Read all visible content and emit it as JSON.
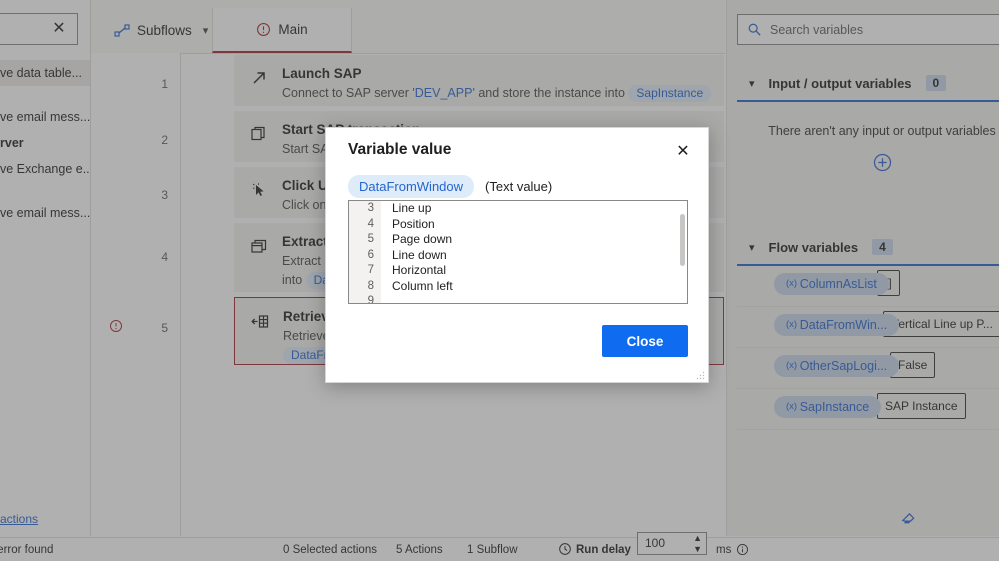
{
  "left_pane": {
    "search": {
      "value": "",
      "clear_icon": "close-icon"
    },
    "tree_items": [
      {
        "label": "ve data table...",
        "selected": true,
        "bold": false
      },
      {
        "label": "",
        "selected": false,
        "bold": false
      },
      {
        "label": "ve email mess...",
        "selected": false,
        "bold": false
      },
      {
        "label": "rver",
        "selected": false,
        "bold": true
      },
      {
        "label": "ve Exchange e...",
        "selected": false,
        "bold": false
      },
      {
        "label": "",
        "selected": false,
        "bold": false
      },
      {
        "label": "ve email mess...",
        "selected": false,
        "bold": false
      }
    ],
    "bottom_link": "actions"
  },
  "tabs": {
    "subflows": {
      "label": "Subflows",
      "icon": "subflow-icon",
      "chevron": "chevron-down-icon"
    },
    "main": {
      "label": "Main",
      "icon": "error-circle-icon",
      "active": true
    }
  },
  "actions": [
    {
      "number": "1",
      "icon": "launch-arrow-icon",
      "title": "Launch SAP",
      "desc_before": "Connect to SAP server ",
      "desc_quoted": "'DEV_APP'",
      "desc_middle": " and store the instance into ",
      "desc_chip": "SapInstance",
      "desc_after": ".",
      "error": false,
      "selected": false
    },
    {
      "number": "2",
      "icon": "copy-icon",
      "title": "Start SAP transaction",
      "desc_before": "Start SAP trans",
      "desc_quoted": "",
      "desc_middle": "",
      "desc_chip": "",
      "desc_after": "",
      "error": false,
      "selected": false
    },
    {
      "number": "3",
      "icon": "click-cursor-icon",
      "title": "Click UI element",
      "desc_before": "Click on UI ele",
      "desc_quoted": "",
      "desc_middle": "",
      "desc_chip": "",
      "desc_after": "",
      "error": false,
      "selected": false
    },
    {
      "number": "4",
      "icon": "extract-windows-icon",
      "title": "Extract data",
      "desc_before": "Extract all reco",
      "desc_quoted": "",
      "desc_middle": "into ",
      "desc_chip": "DataFrom",
      "desc_after": "",
      "error": false,
      "selected": false
    },
    {
      "number": "5",
      "icon": "retrieve-table-icon",
      "title": "Retrieve data",
      "desc_before": "Retrieve the co",
      "desc_quoted": "",
      "desc_middle": "",
      "desc_chip": "DataFromWi",
      "desc_after": "",
      "error": true,
      "selected": true
    }
  ],
  "right_pane": {
    "search": {
      "placeholder": "Search variables",
      "value": "",
      "icon": "search-icon"
    },
    "input_output": {
      "title": "Input / output variables",
      "count": "0",
      "chevron": "chevron-down-icon",
      "empty_message": "There aren't any input or output variables",
      "add_icon": "add-circle-icon"
    },
    "flow_variables": {
      "title": "Flow variables",
      "count": "4",
      "chevron": "chevron-down-icon",
      "rows": [
        {
          "name": "ColumnAsList",
          "value": "[]"
        },
        {
          "name": "DataFromWin...",
          "value": "Vertical  Line up  P..."
        },
        {
          "name": "OtherSapLogi...",
          "value": "False"
        },
        {
          "name": "SapInstance",
          "value": "SAP Instance"
        }
      ]
    },
    "eraser_icon": "eraser-icon"
  },
  "statusbar": {
    "error_text": "me error found",
    "selected_actions": "0 Selected actions",
    "actions_count": "5 Actions",
    "subflow_count": "1 Subflow",
    "run_delay_label": "Run delay",
    "run_delay_icon": "clock-icon",
    "run_delay_value": "100",
    "unit": "ms",
    "info_icon": "info-icon"
  },
  "modal": {
    "title": "Variable value",
    "close_icon": "close-icon",
    "variable_name": "DataFromWindow",
    "variable_type": "(Text value)",
    "rows": [
      {
        "num": "3",
        "text": "Line up"
      },
      {
        "num": "4",
        "text": "Position"
      },
      {
        "num": "5",
        "text": "Page down"
      },
      {
        "num": "6",
        "text": "Line down"
      },
      {
        "num": "7",
        "text": "Horizontal"
      },
      {
        "num": "8",
        "text": "Column left"
      },
      {
        "num": "9",
        "text": ""
      }
    ],
    "close_button": "Close"
  },
  "colors": {
    "accent_blue": "#2564cf",
    "button_blue": "#0f6cf0",
    "error_red": "#a4262c",
    "chip_bg": "#deecf9",
    "panel_bg": "#f3f2f1"
  }
}
